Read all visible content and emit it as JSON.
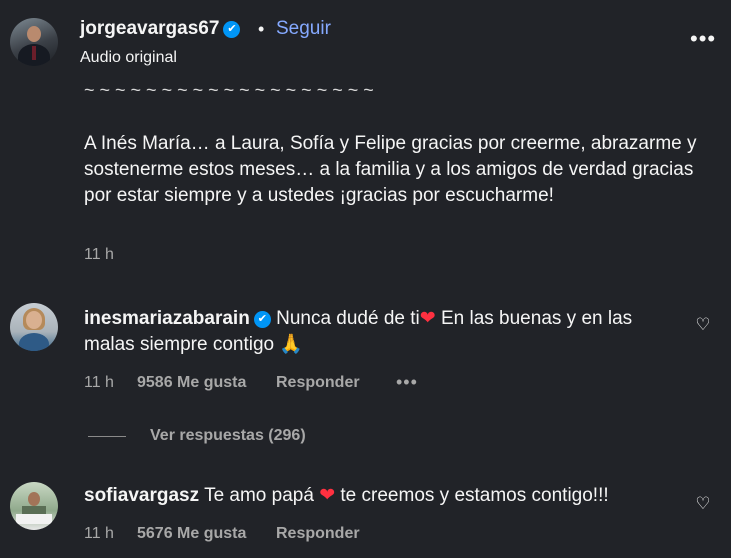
{
  "header": {
    "username": "jorgeavargas67",
    "verified_glyph": "✔",
    "separator": "•",
    "follow_label": "Seguir",
    "subtitle": "Audio original",
    "more_glyph": "•••"
  },
  "caption": {
    "cut_line": "~ ~ ~ ~ ~ ~ ~ ~ ~ ~ ~ ~ ~ ~ ~ ~ ~ ~ ~",
    "text": "A Inés María… a Laura, Sofía y Felipe gracias por creerme, abrazarme y sostenerme estos meses… a la familia y a los amigos de verdad gracias por estar siempre y a ustedes ¡gracias por escucharme!",
    "time": "11 h"
  },
  "comments": [
    {
      "user": "inesmariazabarain",
      "verified_glyph": "✔",
      "text_before_heart": "Nunca dudé de ti",
      "heart": "❤",
      "text_after_heart": " En las buenas y en las malas siempre contigo ",
      "emoji_end": "🙏",
      "time": "11 h",
      "likes": "9586 Me gusta",
      "reply_label": "Responder",
      "options_glyph": "•••",
      "view_replies": "Ver respuestas (296)"
    },
    {
      "user": "sofiavargasz",
      "text_before_heart": "Te amo papá ",
      "heart": "❤",
      "text_after_heart": " te creemos y estamos contigo!!!",
      "time": "11 h",
      "likes": "5676 Me gusta",
      "reply_label": "Responder"
    }
  ],
  "icons": {
    "like": "♡"
  },
  "colors": {
    "background": "#212328",
    "link_blue": "#85a9ff",
    "verified": "#0095f6",
    "heart_red": "#ff3040",
    "muted": "#a8a8a8"
  }
}
